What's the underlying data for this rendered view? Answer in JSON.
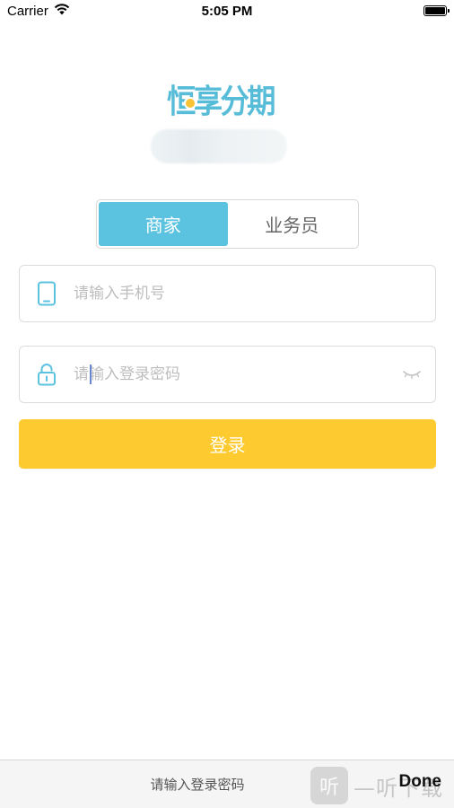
{
  "status_bar": {
    "carrier": "Carrier",
    "time": "5:05 PM",
    "battery_level": 1.0
  },
  "logo": {
    "brand_text": "恒享分期"
  },
  "segmented_control": {
    "options": [
      "商家",
      "业务员"
    ],
    "selected": "商家"
  },
  "phone_field": {
    "placeholder": "请输入手机号",
    "value": ""
  },
  "password_field": {
    "placeholder": "请输入登录密码",
    "value": ""
  },
  "login_button": {
    "label": "登录"
  },
  "keyboard_toolbar": {
    "hint": "请输入登录密码",
    "done_label": "Done",
    "watermark_badge": "听",
    "watermark_text": "—听下载"
  },
  "colors": {
    "accent_blue": "#5bc2df",
    "button_yellow": "#fdcb30",
    "border_gray": "#dcdcdc",
    "placeholder_gray": "#bdbdbd"
  },
  "icons": {
    "phone": "phone-icon",
    "lock": "lock-icon",
    "eye": "eye-closed-icon",
    "wifi": "wifi-icon",
    "battery": "battery-icon"
  }
}
